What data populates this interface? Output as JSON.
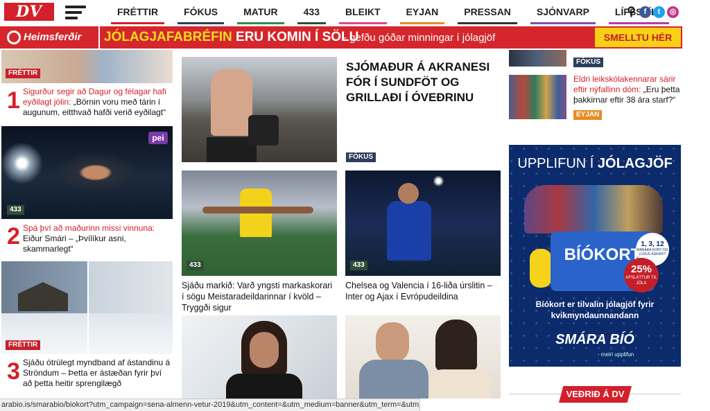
{
  "logo": "DV",
  "nav": [
    {
      "label": "FRÉTTIR",
      "color": "#d3202b"
    },
    {
      "label": "FÓKUS",
      "color": "#2c3e5a"
    },
    {
      "label": "MATUR",
      "color": "#2d8a4a"
    },
    {
      "label": "433",
      "color": "#2f4d35"
    },
    {
      "label": "BLEIKT",
      "color": "#e0448e"
    },
    {
      "label": "EYJAN",
      "color": "#e98a23"
    },
    {
      "label": "PRESSAN",
      "color": "#333333"
    },
    {
      "label": "SJÓNVARP",
      "color": "#7a4fb0"
    },
    {
      "label": "LÍFSSTÍLL",
      "color": "#b23ea0"
    }
  ],
  "nav_icons": [
    {
      "name": "search-icon",
      "glyph": "⚲",
      "color": "#111111"
    },
    {
      "name": "facebook-icon",
      "glyph": "f",
      "color": "#3b5998"
    },
    {
      "name": "twitter-icon",
      "glyph": "t",
      "color": "#1da1f2"
    },
    {
      "name": "instagram-icon",
      "glyph": "◎",
      "color": "#c13584"
    }
  ],
  "promo": {
    "brand": "Heimsferðir",
    "headline_yellow": "JÓLAGJAFABRÉFIN",
    "headline_white": "ERU KOMIN Í SÖLU",
    "sub": "- gefðu góðar minningar í jólagjöf",
    "cta": "SMELLTU HÉR"
  },
  "left_col": [
    {
      "tag": "FRÉTTIR",
      "num": "1",
      "lead_red": "Sigurður segir að Dagur og félagar hafi eyðilagt jólin:",
      "lead": " „Börnin voru með tárin í augunum, eitthvað hafði verið eyðilagt“"
    },
    {
      "tag": "433",
      "num": "2",
      "badge": "pei",
      "lead_red": "Spá því að maðurinn missi vinnuna:",
      "lead": " Eiður Smári – „Þvílíkur asni, skammarlegt“"
    },
    {
      "tag": "FRÉTTIR",
      "num": "3",
      "lead_red": "",
      "lead": "Sjáðu ótrúlegt myndband af ástandinu á Ströndum – Þetta er ástæðan fyrir því að þetta heitir sprengilægð"
    }
  ],
  "mid_top": {
    "headline": "SJÓMAÐUR Á AKRANESI FÓR Í SUNDFÖT OG GRILLAÐI Í ÓVEÐRINU",
    "tag": "FÓKUS"
  },
  "mid_cards": [
    {
      "tag": "433",
      "title": "Sjáðu markið: Varð yngsti markaskorari í sögu Meistaradeildarinnar í kvöld – Tryggði sigur"
    },
    {
      "tag": "433",
      "title": "Chelsea og Valencia í 16-liða úrslitin – Inter og Ajax í Evrópudeildina"
    }
  ],
  "right_col": {
    "tag1": "FÓKUS",
    "story_red": "Eldri leikskólakennarar sárir eftir nýfallinn dóm:",
    "story": " „Eru þetta þakkirnar eftir 38 ára starf?“",
    "tag2": "EYJAN"
  },
  "ad": {
    "head_thin": "UPPLIFUN Í ",
    "head_bold": "JÓLAGJÖF",
    "card": "BÍÓKORT",
    "dates": "1, 3, 12",
    "dates_sub": "MÁNAÐA KORT OG LÚXUS ÁSKRIFT",
    "pct": "25%",
    "pct_sub": "AFSLÁTTUR TIL JÓLA",
    "copy1": "Bíókort er tilvalin jólagjöf fyrir",
    "copy2": "kvikmyndaunnandann",
    "logo": "SMÁRA  BÍÓ",
    "tagline": "- meiri upplifun"
  },
  "weather": "VEÐRIÐ Á DV",
  "status_url": "arabio.is/smarabio/biokort?utm_campaign=sena-almenn-vetur-2019&utm_content=&utm_medium=banner&utm_term=&utm_source=dv.is"
}
